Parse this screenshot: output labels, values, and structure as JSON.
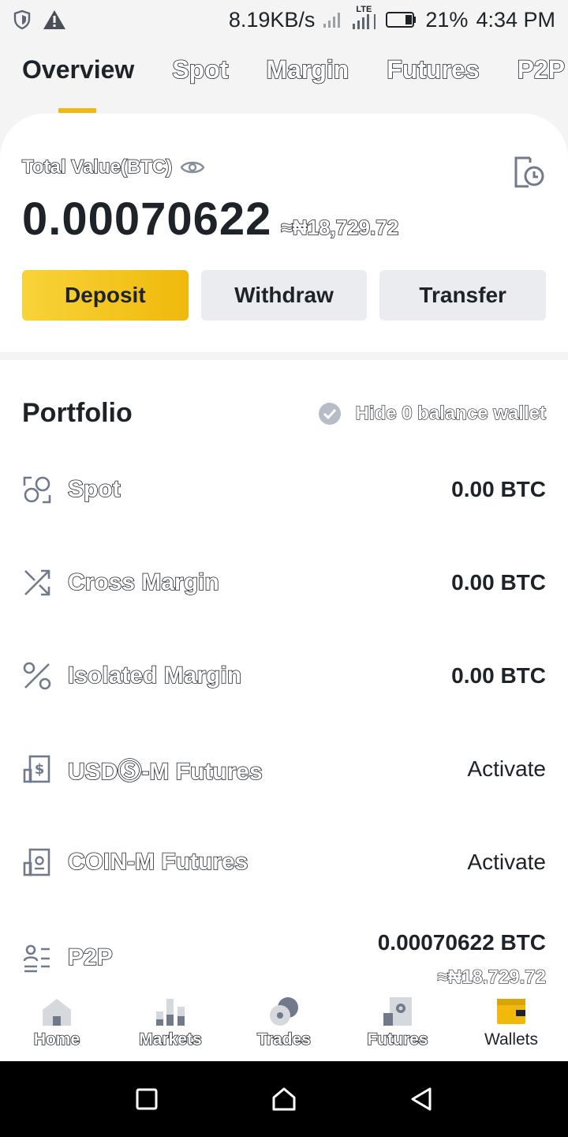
{
  "status_bar": {
    "net_speed": "8.19KB/s",
    "network_type": "LTE",
    "battery": "21%",
    "time": "4:34 PM",
    "left_icons": [
      "shield-icon",
      "warning-icon"
    ]
  },
  "tabs": [
    {
      "label": "Overview",
      "active": true
    },
    {
      "label": "Spot",
      "active": false
    },
    {
      "label": "Margin",
      "active": false
    },
    {
      "label": "Futures",
      "active": false
    },
    {
      "label": "P2P",
      "active": false
    }
  ],
  "summary": {
    "total_label": "Total Value(BTC)",
    "btc_value": "0.00070622",
    "fiat_value": "≈₦18,729.72"
  },
  "actions": {
    "deposit": "Deposit",
    "withdraw": "Withdraw",
    "transfer": "Transfer"
  },
  "portfolio": {
    "title": "Portfolio",
    "hide_zero_label": "Hide 0 balance wallet",
    "rows": [
      {
        "name": "Spot",
        "value": "0.00 BTC",
        "icon": "spot-icon"
      },
      {
        "name": "Cross Margin",
        "value": "0.00 BTC",
        "icon": "cross-margin-icon"
      },
      {
        "name": "Isolated Margin",
        "value": "0.00 BTC",
        "icon": "isolated-margin-icon"
      },
      {
        "name": "USDⓈ-M Futures",
        "value": "Activate",
        "icon": "usd-futures-icon"
      },
      {
        "name": "COIN-M Futures",
        "value": "Activate",
        "icon": "coin-futures-icon"
      },
      {
        "name": "P2P",
        "value": "0.00070622 BTC",
        "fiat": "≈₦18,729.72",
        "icon": "p2p-icon"
      }
    ]
  },
  "bottom_nav": [
    {
      "label": "Home",
      "icon": "home-icon",
      "active": false
    },
    {
      "label": "Markets",
      "icon": "markets-icon",
      "active": false
    },
    {
      "label": "Trades",
      "icon": "trades-icon",
      "active": false
    },
    {
      "label": "Futures",
      "icon": "futures-icon",
      "active": false
    },
    {
      "label": "Wallets",
      "icon": "wallets-icon",
      "active": true
    }
  ],
  "colors": {
    "accent": "#f0b90b",
    "text": "#1e2329",
    "muted": "#b7bdc6",
    "icon_grey": "#707a8a"
  }
}
